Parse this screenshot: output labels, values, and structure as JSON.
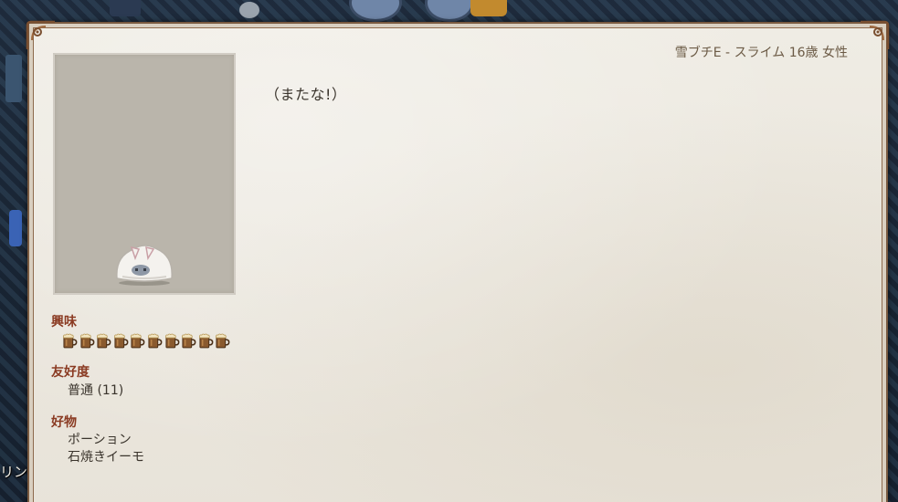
{
  "header": {
    "character_info": "雪ブチE - スライム 16歳 女性"
  },
  "dialogue": {
    "text": "（またな!）"
  },
  "interest": {
    "label": "興味",
    "level": 10,
    "max": 10,
    "icon": "beer-mug-icon"
  },
  "friendship": {
    "label": "友好度",
    "value": "普通 (11)"
  },
  "likes": {
    "label": "好物",
    "items": [
      "ポーション",
      "石焼きイーモ"
    ]
  },
  "edge_text": "リン",
  "colors": {
    "parchment": "#ebe7de",
    "section_title": "#8a3a22",
    "body_text": "#3a342c",
    "header_text": "#6b5a45",
    "portrait_bg": "#bab5ab"
  }
}
